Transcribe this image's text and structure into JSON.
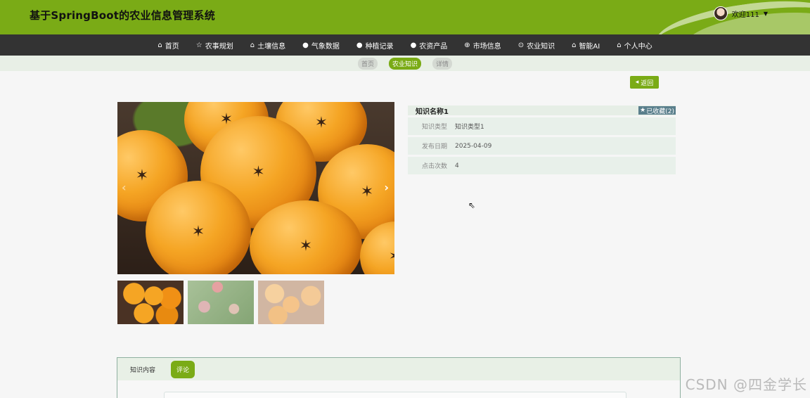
{
  "header": {
    "title": "基于SpringBoot的农业信息管理系统",
    "user": "欢迎111"
  },
  "nav": [
    {
      "icon": "⌂",
      "label": "首页"
    },
    {
      "icon": "☆",
      "label": "农事规划"
    },
    {
      "icon": "⌂",
      "label": "土壤信息"
    },
    {
      "icon": "●",
      "label": "气象数据"
    },
    {
      "icon": "●",
      "label": "种植记录"
    },
    {
      "icon": "●",
      "label": "农资产品"
    },
    {
      "icon": "⊕",
      "label": "市场信息"
    },
    {
      "icon": "⊙",
      "label": "农业知识"
    },
    {
      "icon": "⌂",
      "label": "智能AI"
    },
    {
      "icon": "⌂",
      "label": "个人中心"
    }
  ],
  "breadcrumb": [
    "首页",
    "农业知识",
    "详情"
  ],
  "back_label": "返回",
  "detail": {
    "name": "知识名称1",
    "favorite": "已收藏(2)",
    "rows": [
      {
        "k": "知识类型",
        "v": "知识类型1"
      },
      {
        "k": "发布日期",
        "v": "2025-04-09"
      },
      {
        "k": "点击次数",
        "v": "4"
      }
    ]
  },
  "tabs": [
    "知识内容",
    "评论"
  ],
  "watermark": "CSDN @四金学长"
}
